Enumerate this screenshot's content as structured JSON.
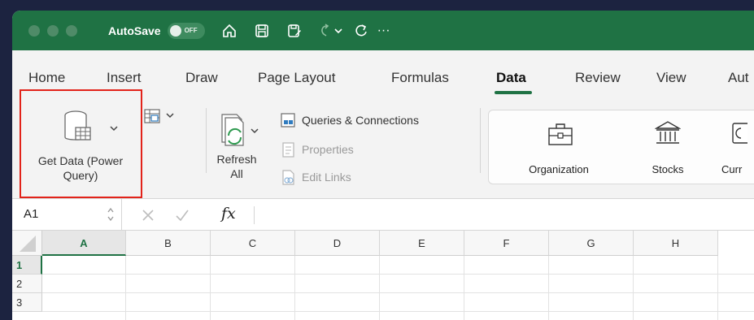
{
  "titlebar": {
    "autosave_label": "AutoSave",
    "toggle_label": "OFF",
    "more_label": "···"
  },
  "tabs": [
    {
      "label": "Home"
    },
    {
      "label": "Insert"
    },
    {
      "label": "Draw"
    },
    {
      "label": "Page Layout"
    },
    {
      "label": "Formulas"
    },
    {
      "label": "Data"
    },
    {
      "label": "Review"
    },
    {
      "label": "View"
    },
    {
      "label": "Aut"
    }
  ],
  "active_tab": "Data",
  "ribbon": {
    "get_data_line1": "Get Data (Power",
    "get_data_line2": "Query)",
    "refresh_line1": "Refresh",
    "refresh_line2": "All",
    "queries_connections": "Queries & Connections",
    "properties": "Properties",
    "edit_links": "Edit Links",
    "data_types": [
      {
        "label": "Organization"
      },
      {
        "label": "Stocks"
      },
      {
        "label": "Curr"
      }
    ]
  },
  "formula_bar": {
    "name_box": "A1",
    "fx": "fx",
    "formula": ""
  },
  "grid": {
    "columns": [
      "A",
      "B",
      "C",
      "D",
      "E",
      "F",
      "G",
      "H"
    ],
    "rows": [
      "1",
      "2",
      "3"
    ],
    "active_cell": "A1"
  },
  "colors": {
    "brand": "#1f7244",
    "highlight": "#e2231a"
  }
}
